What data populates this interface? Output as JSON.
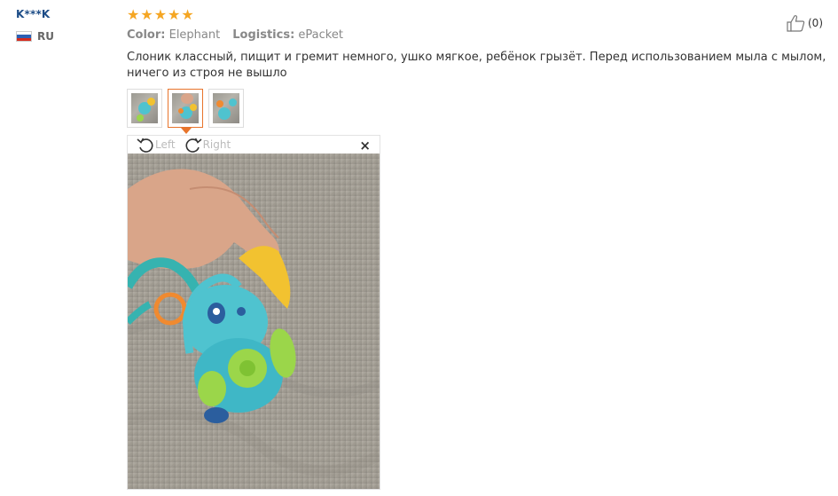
{
  "user": {
    "name": "K***K",
    "country": "RU",
    "flag_colors": [
      "#ffffff",
      "#2c5fb3",
      "#d52b1e"
    ]
  },
  "review": {
    "rating": 5,
    "star_glyph": "★",
    "star_color": "#f5a623",
    "color_label": "Color:",
    "color_value": "Elephant",
    "logistics_label": "Logistics:",
    "logistics_value": "ePacket",
    "text": "Слоник классный, пищит и гремит немного, ушко мягкое, ребёнок грызёт. Перед использованием мыла с мылом, ничего из строя не вышло",
    "likes": "(0)"
  },
  "viewer": {
    "rotate_left_label": "Left",
    "rotate_right_label": "Right",
    "close_glyph": "×",
    "active_thumb_index": 1,
    "thumb_count": 3,
    "accent_color": "#e8742b"
  }
}
